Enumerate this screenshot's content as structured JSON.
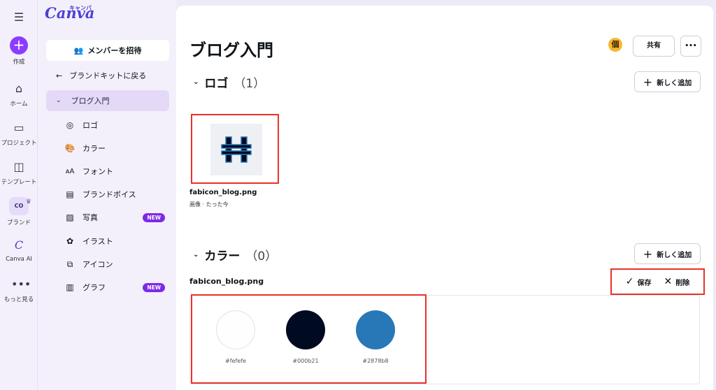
{
  "rail": {
    "collapse_icon": "collapse-sidebar-icon",
    "items": [
      {
        "label": "作成"
      },
      {
        "label": "ホーム"
      },
      {
        "label": "プロジェクト"
      },
      {
        "label": "テンプレート"
      },
      {
        "label": "ブランド"
      },
      {
        "label": "Canva AI"
      },
      {
        "label": "もっと見る"
      }
    ],
    "brand_icon_text": "CO"
  },
  "sidebar": {
    "logo": "Canva",
    "logo_kana": "キャンバ",
    "invite_label": "メンバーを招待",
    "back_label": "ブランドキットに戻る",
    "kit_label": "ブログ入門",
    "items": [
      {
        "label": "ロゴ",
        "icon": "logo-icon"
      },
      {
        "label": "カラー",
        "icon": "palette-icon"
      },
      {
        "label": "フォント",
        "icon": "font-icon"
      },
      {
        "label": "ブランドボイス",
        "icon": "brand-voice-icon"
      },
      {
        "label": "写真",
        "icon": "photo-icon",
        "badge": "NEW"
      },
      {
        "label": "イラスト",
        "icon": "illustration-icon"
      },
      {
        "label": "アイコン",
        "icon": "icons-icon"
      },
      {
        "label": "グラフ",
        "icon": "chart-icon",
        "badge": "NEW"
      }
    ]
  },
  "main": {
    "title": "ブログ入門",
    "badge": "個",
    "share_label": "共有",
    "more_label": "•••",
    "logo_section": {
      "title": "ロゴ",
      "count": "（1）",
      "add_label": "新しく追加"
    },
    "logo_file": {
      "name": "fabicon_blog.png",
      "meta": "画像 · たった今"
    },
    "color_section": {
      "title": "カラー",
      "count": "（0）",
      "add_label": "新しく追加"
    },
    "palette": {
      "name": "fabicon_blog.png",
      "save_label": "保存",
      "delete_label": "削除",
      "colors": [
        {
          "hex": "#fefefe",
          "label": "#fefefe"
        },
        {
          "hex": "#000b21",
          "label": "#000b21"
        },
        {
          "hex": "#2878b8",
          "label": "#2878b8"
        }
      ]
    }
  },
  "colors": {
    "accent": "#8b3dff",
    "highlight": "#e8322a",
    "new_badge": "#7d2ae8"
  }
}
